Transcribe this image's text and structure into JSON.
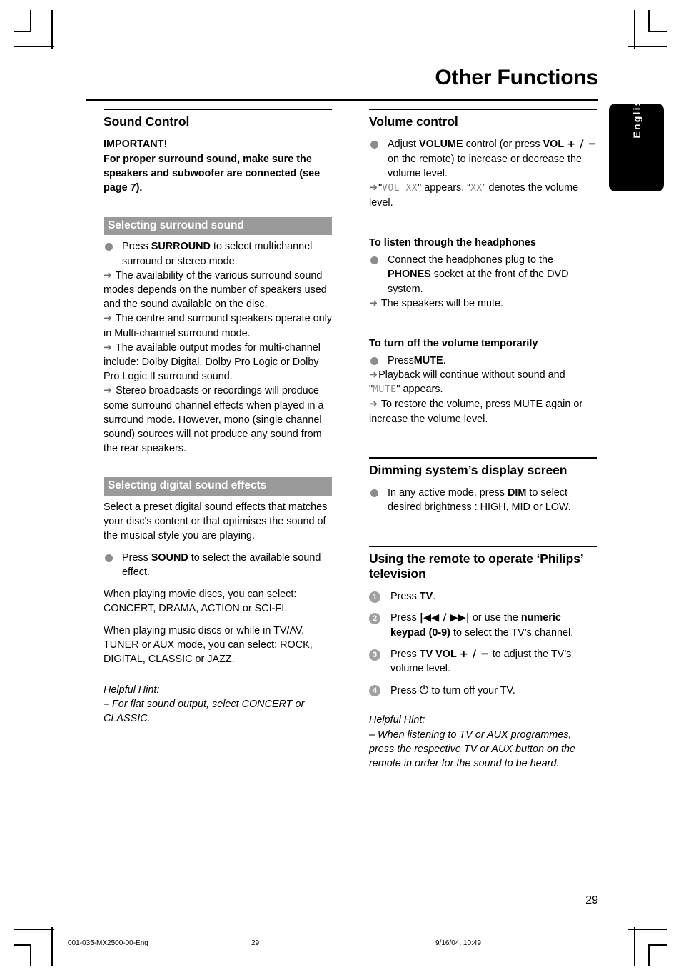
{
  "page": {
    "title": "Other Functions",
    "language_tab": "English",
    "page_number": "29"
  },
  "footer": {
    "file": "001-035-MX2500-00-Eng",
    "page": "29",
    "date": "9/16/04, 10:49"
  },
  "colors": {
    "banner_bg": "#9a9a9a",
    "bullet": "#8c8c8c",
    "num_badge": "#a0a0a0",
    "lcd_text": "#8a8a8a"
  },
  "left_column": {
    "sound_control": {
      "heading": "Sound Control",
      "important_label": "IMPORTANT!",
      "important_text": "For proper surround sound, make sure the speakers and subwoofer are connected (see page 7)."
    },
    "surround": {
      "banner": "Selecting surround sound",
      "bullet_lead": "Press",
      "bullet_bold": "SURROUND",
      "bullet_rest": "to select multichannel surround or stereo mode.",
      "arrows": [
        "The availability of the various surround sound modes depends on the number of speakers used and the sound available on the disc.",
        "The centre and surround speakers operate only in Multi-channel surround mode.",
        "The available output modes for multi-channel include: Dolby Digital, Dolby Pro Logic or Dolby Pro Logic II surround sound.",
        "Stereo broadcasts or recordings will produce some surround channel effects when played in a surround mode. However, mono (single channel sound) sources will not produce any sound from the rear speakers."
      ]
    },
    "digital_effects": {
      "banner": "Selecting digital sound effects",
      "intro": "Select a preset digital sound effects that matches your disc's content or that optimises the sound of the musical style you are playing.",
      "bullet_lead": "Press",
      "bullet_bold": "SOUND",
      "bullet_rest": "to select the available sound effect.",
      "movie_line": "When playing movie discs, you can select: CONCERT, DRAMA, ACTION or SCI-FI.",
      "music_line": "When playing music discs or while in TV/AV,  TUNER or AUX  mode, you can select: ROCK, DIGITAL, CLASSIC or JAZZ.",
      "hint_head": "Helpful Hint:",
      "hint_body": "–  For flat sound output, select CONCERT or CLASSIC."
    }
  },
  "right_column": {
    "volume_control": {
      "heading": "Volume control",
      "bullet_lead": "Adjust",
      "bullet_bold1": "VOLUME",
      "bullet_mid": "control (or press",
      "bullet_bold2": "VOL",
      "bullet_plusminus": "+ / −",
      "bullet_rest": "on the remote) to increase or decrease the volume level.",
      "arrow_pre": "\"",
      "arrow_lcd1": "VOL XX",
      "arrow_mid": "\" appears. “",
      "arrow_lcd2": "XX",
      "arrow_post": "” denotes the volume level."
    },
    "headphones": {
      "heading": "To listen through the headphones",
      "bullet_lead": "Connect the headphones plug to the",
      "bullet_bold": "PHONES",
      "bullet_rest": "socket at the front of the DVD system.",
      "arrow": "The speakers will be mute."
    },
    "mute": {
      "heading": "To turn off the volume temporarily",
      "bullet_lead": "Press",
      "bullet_bold": "MUTE",
      "bullet_rest": ".",
      "arrow1_pre": "Playback will continue without sound and \"",
      "arrow1_lcd": "MUTE",
      "arrow1_post": "\" appears.",
      "arrow2": "To restore the volume, press MUTE again or increase the volume level."
    },
    "dimming": {
      "heading": "Dimming system’s display screen",
      "bullet_lead": "In any active mode, press",
      "bullet_bold": "DIM",
      "bullet_rest": "to select desired brightness : HIGH, MID or LOW."
    },
    "tv_remote": {
      "heading": "Using the remote to operate ‘Philips’ television",
      "steps": [
        {
          "num": "1",
          "lead": "Press",
          "bold": "TV",
          "rest": "."
        },
        {
          "num": "2",
          "lead": "Press",
          "symbols": "|◀◀ / ▶▶|",
          "mid": "or use the",
          "bold": "numeric keypad (0-9)",
          "rest": "to select the TV’s channel."
        },
        {
          "num": "3",
          "lead": "Press",
          "bold": "TV VOL",
          "plusminus": "+ / −",
          "rest": "to adjust the TV’s volume level."
        },
        {
          "num": "4",
          "lead": "Press",
          "symbols": "⏻",
          "rest": "to turn off your TV."
        }
      ],
      "hint_head": "Helpful Hint:",
      "hint_body": "–  When listening to TV or AUX programmes, press the respective TV or AUX button on the remote in order for the sound to be heard."
    }
  }
}
